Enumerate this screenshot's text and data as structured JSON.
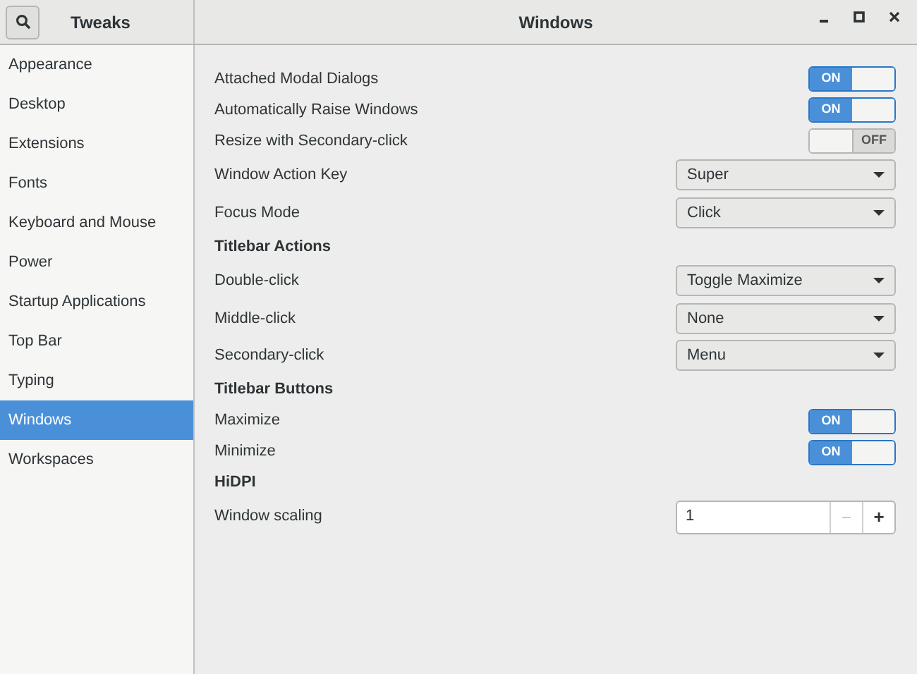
{
  "header": {
    "app_title": "Tweaks",
    "window_title": "Windows"
  },
  "sidebar": {
    "items": [
      {
        "label": "Appearance",
        "selected": false
      },
      {
        "label": "Desktop",
        "selected": false
      },
      {
        "label": "Extensions",
        "selected": false
      },
      {
        "label": "Fonts",
        "selected": false
      },
      {
        "label": "Keyboard and Mouse",
        "selected": false
      },
      {
        "label": "Power",
        "selected": false
      },
      {
        "label": "Startup Applications",
        "selected": false
      },
      {
        "label": "Top Bar",
        "selected": false
      },
      {
        "label": "Typing",
        "selected": false
      },
      {
        "label": "Windows",
        "selected": true
      },
      {
        "label": "Workspaces",
        "selected": false
      }
    ]
  },
  "settings": [
    {
      "kind": "switch",
      "label": "Attached Modal Dialogs",
      "on": true,
      "state_label": "ON"
    },
    {
      "kind": "switch",
      "label": "Automatically Raise Windows",
      "on": true,
      "state_label": "ON"
    },
    {
      "kind": "switch",
      "label": "Resize with Secondary-click",
      "on": false,
      "state_label": "OFF"
    },
    {
      "kind": "combo",
      "label": "Window Action Key",
      "value": "Super"
    },
    {
      "kind": "combo",
      "label": "Focus Mode",
      "value": "Click"
    },
    {
      "kind": "heading",
      "label": "Titlebar Actions"
    },
    {
      "kind": "combo",
      "label": "Double-click",
      "value": "Toggle Maximize"
    },
    {
      "kind": "combo",
      "label": "Middle-click",
      "value": "None"
    },
    {
      "kind": "combo",
      "label": "Secondary-click",
      "value": "Menu"
    },
    {
      "kind": "heading",
      "label": "Titlebar Buttons"
    },
    {
      "kind": "switch",
      "label": "Maximize",
      "on": true,
      "state_label": "ON"
    },
    {
      "kind": "switch",
      "label": "Minimize",
      "on": true,
      "state_label": "ON"
    },
    {
      "kind": "heading",
      "label": "HiDPI"
    },
    {
      "kind": "spin",
      "label": "Window scaling",
      "value": "1",
      "minus": "−",
      "plus": "+",
      "minus_disabled": true
    }
  ]
}
